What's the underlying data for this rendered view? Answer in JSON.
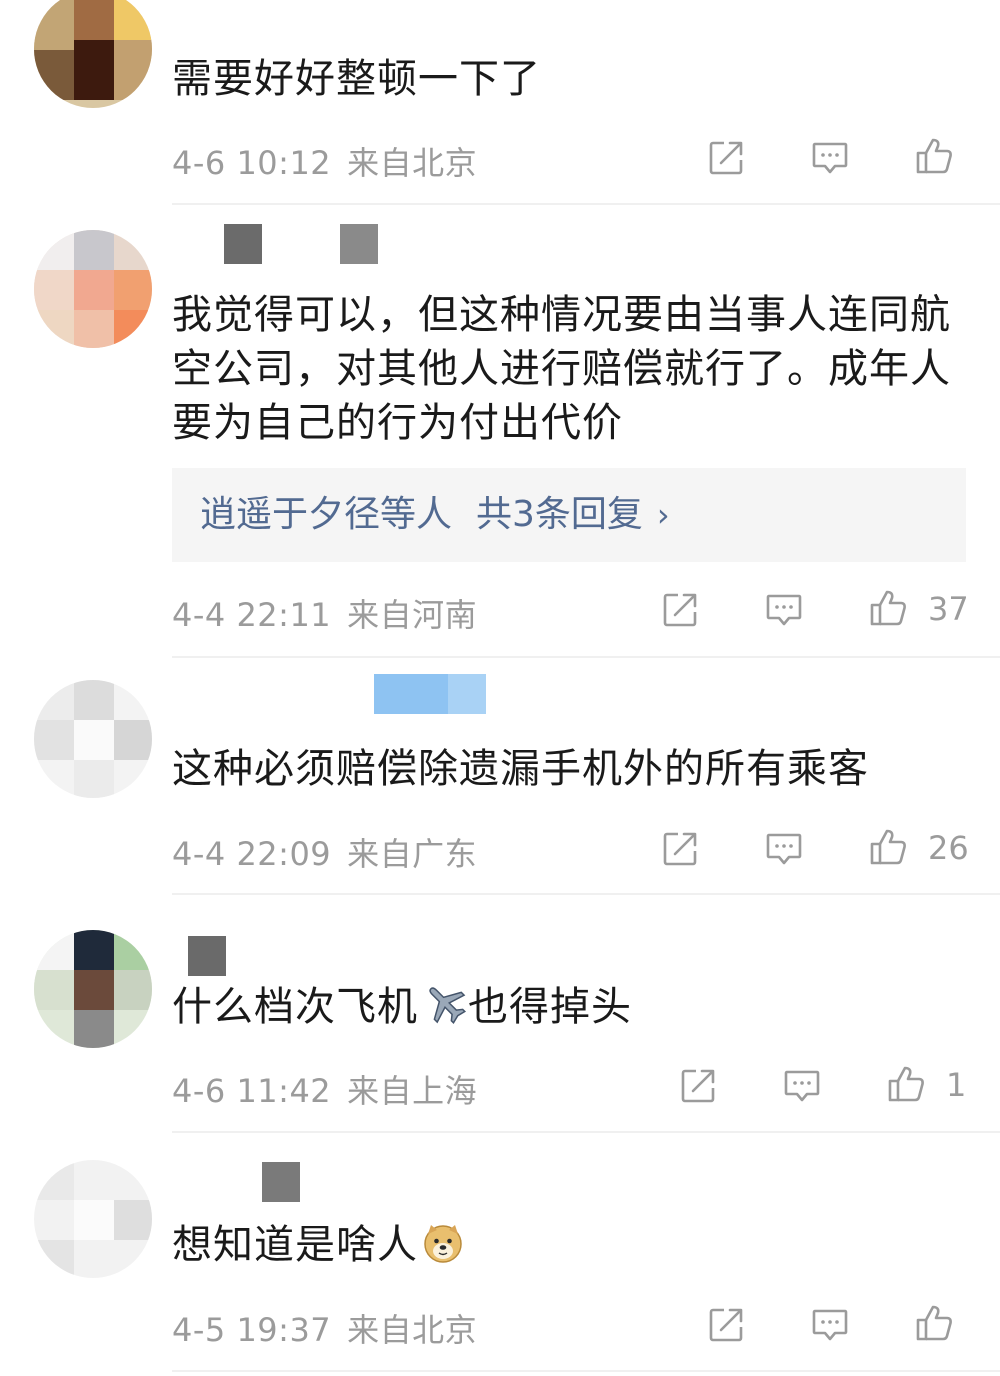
{
  "comments": [
    {
      "text": "需要好好整顿一下了",
      "date": "4-6 10:12",
      "location": "来自北京",
      "likes": ""
    },
    {
      "text": "我觉得可以，但这种情况要由当事人连同航空公司，对其他人进行赔偿就行了。成年人要为自己的行为付出代价",
      "date": "4-4 22:11",
      "location": "来自河南",
      "likes": "37",
      "replies": {
        "who": "逍遥于夕径等人",
        "total": "共3条回复",
        "chevron": "›"
      }
    },
    {
      "text": "这种必须赔偿除遗漏手机外的所有乘客",
      "date": "4-4 22:09",
      "location": "来自广东",
      "likes": "26"
    },
    {
      "text": "什么档次飞机",
      "text_after": "也得掉头",
      "emoji": "airplane-emoji",
      "date": "4-6 11:42",
      "location": "来自上海",
      "likes": "1"
    },
    {
      "text": "想知道是啥人",
      "emoji": "doge-emoji",
      "date": "4-5 19:37",
      "location": "来自北京",
      "likes": ""
    }
  ],
  "icons": {
    "share": "share-icon",
    "comment": "comment-icon",
    "like": "thumbs-up-icon"
  },
  "colors": {
    "text": "#1a1a1a",
    "meta": "#9b9b9b",
    "reply_link": "#526a91",
    "reply_bg": "#f5f5f5"
  }
}
